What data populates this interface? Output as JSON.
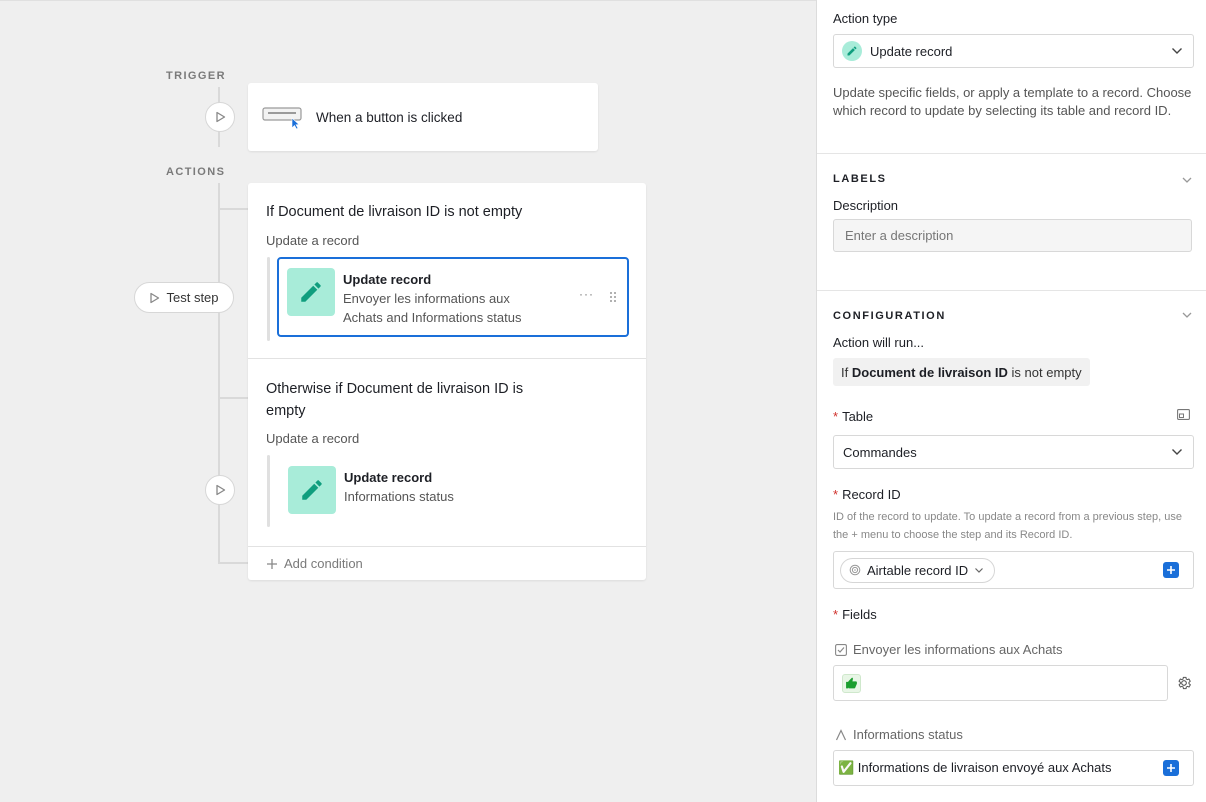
{
  "canvas": {
    "trigger_label": "TRIGGER",
    "actions_label": "ACTIONS",
    "trigger_title": "When a button is clicked",
    "test_step_label": "Test step",
    "branch1": {
      "title": "If Document de livraison ID is not empty",
      "subtitle": "Update a record",
      "step_title": "Update record",
      "step_desc": "Envoyer les informations aux Achats and Informations status"
    },
    "branch2": {
      "title": "Otherwise if Document de livraison ID is empty",
      "subtitle": "Update a record",
      "step_title": "Update record",
      "step_desc": "Informations status"
    },
    "add_condition_label": "Add condition",
    "more_label": "···"
  },
  "panel": {
    "action_type_label": "Action type",
    "action_type_value": "Update record",
    "action_description": "Update specific fields, or apply a template to a record. Choose which record to update by selecting its table and record ID.",
    "labels_heading": "LABELS",
    "description_label": "Description",
    "description_placeholder": "Enter a description",
    "configuration_heading": "CONFIGURATION",
    "action_will_run_label": "Action will run...",
    "condition": {
      "prefix": "If",
      "field": "Document de livraison ID",
      "suffix": "is not empty"
    },
    "table_label": "Table",
    "table_value": "Commandes",
    "record_id_label": "Record ID",
    "record_id_help": "ID of the record to update. To update a record from a previous step, use the + menu to choose the step and its Record ID.",
    "record_id_token": "Airtable record ID",
    "fields_label": "Fields",
    "field1_name": "Envoyer les informations aux Achats",
    "field2_name": "Informations status",
    "field2_value": "✅ Informations de livraison envoyé aux Achats",
    "required_mark": "*"
  },
  "colors": {
    "accent_blue": "#1a6fd9",
    "step_icon_bg": "#a8ecd9",
    "step_icon_fg": "#0f9e7e",
    "thumbs_green": "#1b9e2f"
  }
}
